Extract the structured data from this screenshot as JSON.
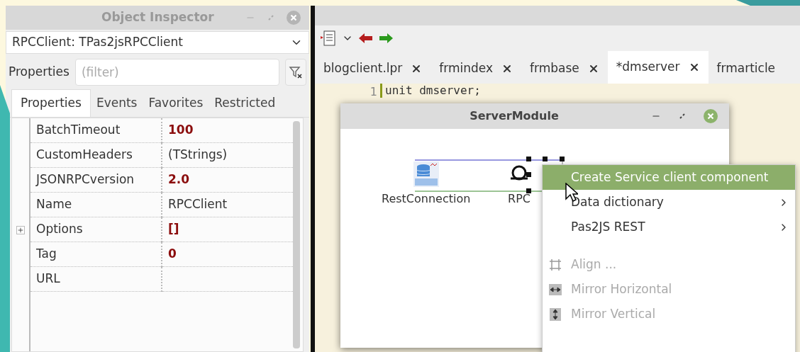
{
  "inspector": {
    "title": "Object Inspector",
    "component": "RPCClient: TPas2jsRPCClient",
    "filter_label": "Properties",
    "filter_placeholder": "(filter)",
    "tabs": [
      {
        "label": "Properties",
        "selected": true
      },
      {
        "label": "Events",
        "selected": false
      },
      {
        "label": "Favorites",
        "selected": false
      },
      {
        "label": "Restricted",
        "selected": false
      }
    ],
    "properties": [
      {
        "name": "BatchTimeout",
        "value": "100",
        "modified": true,
        "expandable": false
      },
      {
        "name": "CustomHeaders",
        "value": "(TStrings)",
        "modified": false,
        "expandable": false
      },
      {
        "name": "JSONRPCversion",
        "value": "2.0",
        "modified": true,
        "expandable": false
      },
      {
        "name": "Name",
        "value": "RPCClient",
        "modified": false,
        "expandable": false
      },
      {
        "name": "Options",
        "value": "[]",
        "modified": true,
        "expandable": true
      },
      {
        "name": "Tag",
        "value": "0",
        "modified": true,
        "expandable": false
      },
      {
        "name": "URL",
        "expandable": false
      }
    ]
  },
  "editor": {
    "tabs": [
      {
        "label": "blogclient.lpr",
        "selected": false
      },
      {
        "label": "frmindex",
        "selected": false
      },
      {
        "label": "frmbase",
        "selected": false
      },
      {
        "label": "*dmserver",
        "selected": true
      },
      {
        "label": "frmarticle",
        "selected": false
      }
    ],
    "line_number": "1",
    "code": "unit dmserver;"
  },
  "designer": {
    "title": "ServerModule",
    "components": [
      {
        "label": "RestConnection",
        "kind": "rest"
      },
      {
        "label": "RPC",
        "kind": "rpc"
      }
    ]
  },
  "context_menu": [
    {
      "label": "Create Service client component",
      "kind": "item",
      "selected": true,
      "disabled": false,
      "submenu": false
    },
    {
      "label": "Data dictionary",
      "kind": "item",
      "selected": false,
      "disabled": false,
      "submenu": true
    },
    {
      "label": "Pas2JS REST",
      "kind": "item",
      "selected": false,
      "disabled": false,
      "submenu": true
    },
    {
      "kind": "separator"
    },
    {
      "label": "Align ...",
      "kind": "align",
      "selected": false,
      "disabled": true,
      "submenu": false
    },
    {
      "label": "Mirror Horizontal",
      "kind": "mirror-h",
      "selected": false,
      "disabled": true,
      "submenu": false
    },
    {
      "label": "Mirror Vertical",
      "kind": "mirror-v",
      "selected": false,
      "disabled": true,
      "submenu": false
    }
  ]
}
